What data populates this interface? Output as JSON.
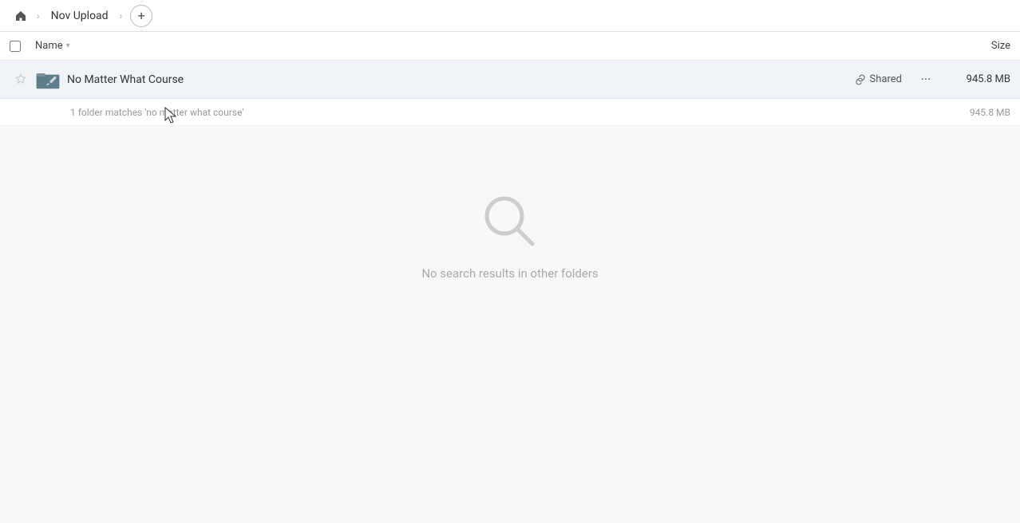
{
  "breadcrumb": {
    "home_icon": "home",
    "items": [
      {
        "label": "Nov Upload"
      }
    ],
    "add_label": "+"
  },
  "column_headers": {
    "name_label": "Name",
    "size_label": "Size"
  },
  "file_row": {
    "name": "No Matter What Course",
    "shared_label": "Shared",
    "size": "945.8 MB",
    "more_icon": "···"
  },
  "match_info": {
    "text": "1 folder matches 'no matter what course'",
    "size": "945.8 MB"
  },
  "empty_state": {
    "message": "No search results in other folders"
  }
}
